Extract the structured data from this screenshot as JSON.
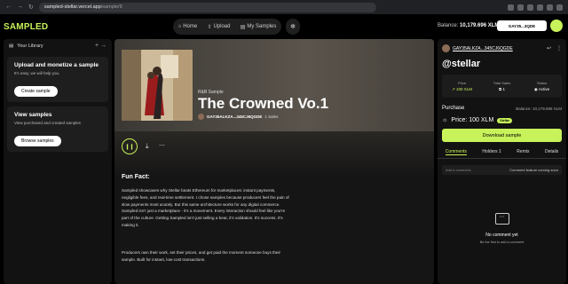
{
  "browser": {
    "url_host": "sampled-stellar.vercel.app",
    "url_path": "/sample/9"
  },
  "app": {
    "logo": "SAMPLED",
    "nav": [
      {
        "label": "Home",
        "icon": "home-icon"
      },
      {
        "label": "Upload",
        "icon": "upload-icon"
      },
      {
        "label": "My Samples",
        "icon": "library-icon"
      }
    ],
    "balance_label": "Balance:",
    "balance_value": "10,179.696 XLM",
    "account": "GAY35...3QDE",
    "accent": "#c8f25a"
  },
  "sidebar": {
    "title": "Your Library",
    "cards": [
      {
        "title": "Upload and monetize a sample",
        "desc": "It's easy, we will help you.",
        "button": "Create sample"
      },
      {
        "title": "View samples",
        "desc": "View purchased and created samples",
        "button": "Browse samples"
      }
    ]
  },
  "sample": {
    "type": "R&B Sample",
    "title": "The Crowned Vo.1",
    "creator": "GAY35ALKZA...345CJ6QGDE",
    "sales": "1 Sales",
    "fun_fact_title": "Fun Fact:",
    "fun_fact_p1": "Sampled showcases why Stellar beats Ethereum for marketplaces: instant payments, negligible fees, and real-time settlement. I chose samples because producers feel the pain of slow payments most acutely. But this same architecture works for any digital commerce. Sampled isn't just a marketplace - it's a movement. Every interaction should feel like you're part of the culture. Getting Sampled isn't just selling a beat, it's validation. It's success. It's making it.",
    "fun_fact_p2": "Producers own their work, set their prices, and get paid the moment someone buys their sample. Built for instant, low-cost transactions."
  },
  "panel": {
    "creator": "GAY35ALKZA...345CJ6QGDE",
    "handle": "@stellar",
    "stats": [
      {
        "label": "Price",
        "value": "100 XLM"
      },
      {
        "label": "Total Sales",
        "value": "1"
      },
      {
        "label": "Status",
        "value": "Active"
      }
    ],
    "purchase_title": "Purchase",
    "purchase_balance": "Balance: 10,179.696 XLM",
    "price": "Price: 100 XLM",
    "price_badge": "Stellar",
    "download_button": "Download sample",
    "tabs": [
      "Comments",
      "Holders",
      "Remix",
      "Details"
    ],
    "holders_count": "1",
    "comment_placeholder": "Add a comment...",
    "comment_status": "Comment feature coming soon",
    "no_comment_title": "No comment yet",
    "no_comment_sub": "Be the first to add a comment"
  }
}
